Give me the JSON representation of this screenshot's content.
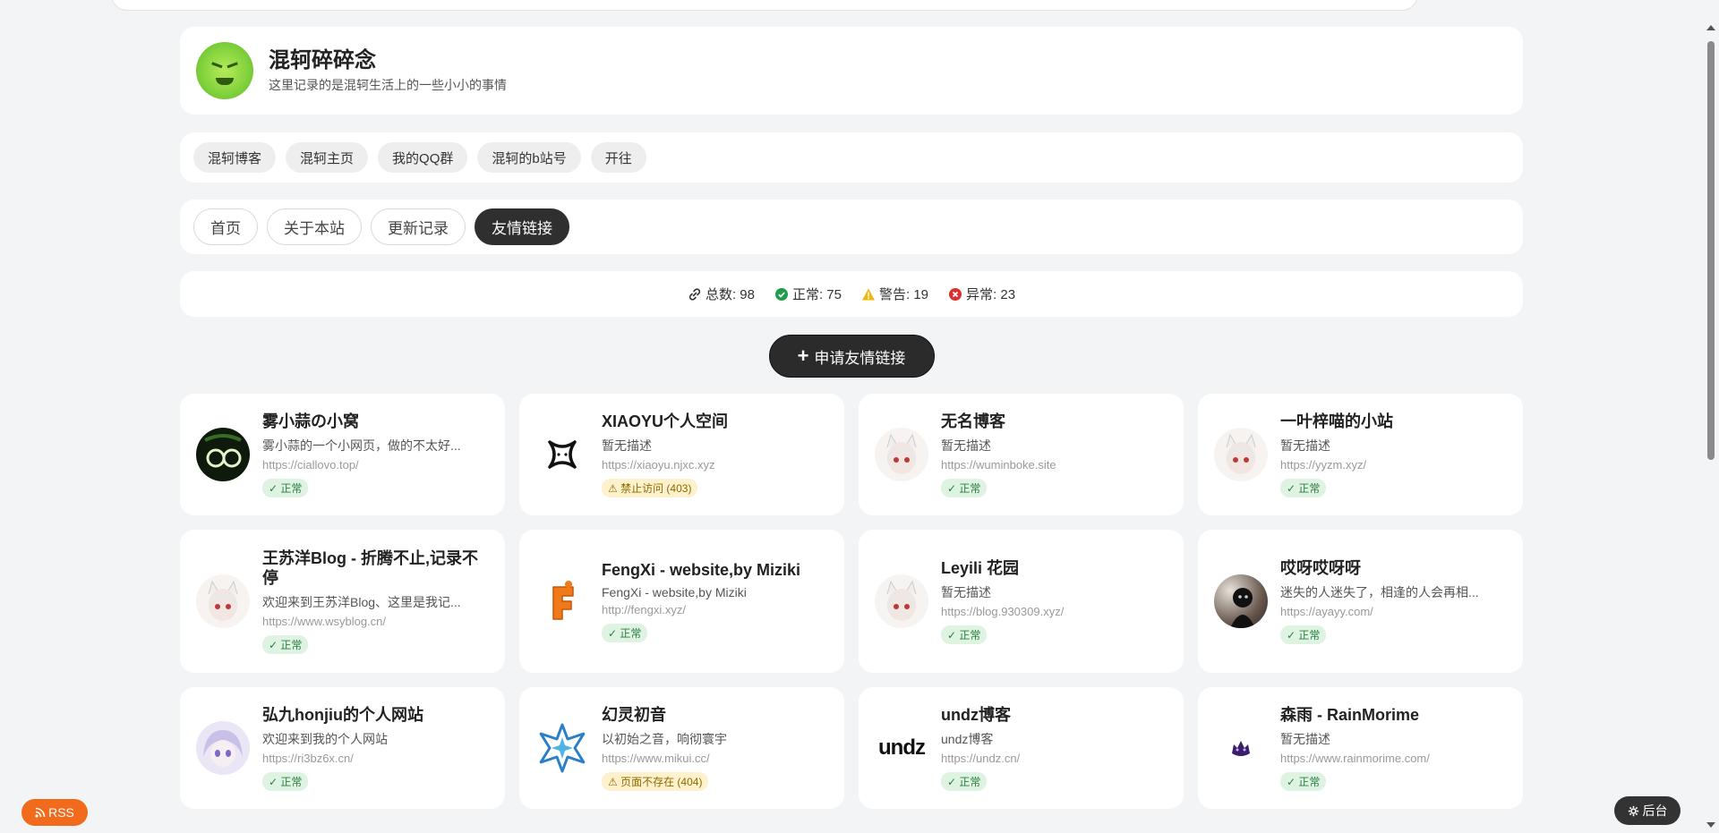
{
  "site": {
    "title": "混轲碎碎念",
    "description": "这里记录的是混轲生活上的一些小小的事情"
  },
  "quicklinks": [
    "混轲博客",
    "混轲主页",
    "我的QQ群",
    "混轲的b站号",
    "开往"
  ],
  "tabs": [
    {
      "label": "首页",
      "active": false
    },
    {
      "label": "关于本站",
      "active": false
    },
    {
      "label": "更新记录",
      "active": false
    },
    {
      "label": "友情链接",
      "active": true
    }
  ],
  "stats": {
    "total": "总数: 98",
    "normal": "正常: 75",
    "warning": "警告: 19",
    "error": "异常: 23"
  },
  "apply_button": "申请友情链接",
  "links": [
    {
      "name": "雾小蒜の小窝",
      "desc": "雾小蒜的一个小网页，做的不太好...",
      "url": "https://ciallovo.top/",
      "status": "✓ 正常",
      "status_type": "ok",
      "avatar_icon": "dark-circles-avatar"
    },
    {
      "name": "XIAOYU个人空间",
      "desc": "暂无描述",
      "url": "https://xiaoyu.njxc.xyz",
      "status": "⚠ 禁止访问 (403)",
      "status_type": "warn",
      "avatar_icon": "x-logo-avatar"
    },
    {
      "name": "无名博客",
      "desc": "暂无描述",
      "url": "https://wuminboke.site",
      "status": "✓ 正常",
      "status_type": "ok",
      "avatar_icon": "anime-girl-avatar"
    },
    {
      "name": "一叶梓喵的小站",
      "desc": "暂无描述",
      "url": "https://yyzm.xyz/",
      "status": "✓ 正常",
      "status_type": "ok",
      "avatar_icon": "anime-girl-avatar"
    },
    {
      "name": "王苏洋Blog - 折腾不止,记录不停",
      "desc": "欢迎来到王苏洋Blog、这里是我记...",
      "url": "https://www.wsyblog.cn/",
      "status": "✓ 正常",
      "status_type": "ok",
      "avatar_icon": "anime-girl-avatar"
    },
    {
      "name": "FengXi - website,by Miziki",
      "desc": "FengXi - website,by Miziki",
      "url": "http://fengxi.xyz/",
      "status": "✓ 正常",
      "status_type": "ok",
      "avatar_icon": "f-letter-avatar"
    },
    {
      "name": "Leyili 花园",
      "desc": "暂无描述",
      "url": "https://blog.930309.xyz/",
      "status": "✓ 正常",
      "status_type": "ok",
      "avatar_icon": "anime-girl-avatar"
    },
    {
      "name": "哎呀哎呀呀",
      "desc": "迷失的人迷失了，相逢的人会再相...",
      "url": "https://ayayy.com/",
      "status": "✓ 正常",
      "status_type": "ok",
      "avatar_icon": "dark-figure-avatar"
    },
    {
      "name": "弘九honjiu的个人网站",
      "desc": "欢迎来到我的个人网站",
      "url": "https://ri3bz6x.cn/",
      "status": "✓ 正常",
      "status_type": "ok",
      "avatar_icon": "purple-anime-avatar"
    },
    {
      "name": "幻灵初音",
      "desc": "以初始之音，响彻寰宇",
      "url": "https://www.mikui.cc/",
      "status": "⚠ 页面不存在 (404)",
      "status_type": "warn",
      "avatar_icon": "star-logo-avatar"
    },
    {
      "name": "undz博客",
      "desc": "undz博客",
      "url": "https://undz.cn/",
      "status": "✓ 正常",
      "status_type": "ok",
      "avatar_icon": "undz-text-avatar"
    },
    {
      "name": "森雨 - RainMorime",
      "desc": "暂无描述",
      "url": "https://www.rainmorime.com/",
      "status": "✓ 正常",
      "status_type": "ok",
      "avatar_icon": "purple-creature-avatar"
    }
  ],
  "undz_logo_text": "undz",
  "float": {
    "rss": "RSS",
    "admin": "后台"
  },
  "colors": {
    "ok_bg": "#dff3e3",
    "warn_bg": "#fff1cc",
    "rss": "#f26a1b",
    "active_tab": "#2f2f2f"
  }
}
